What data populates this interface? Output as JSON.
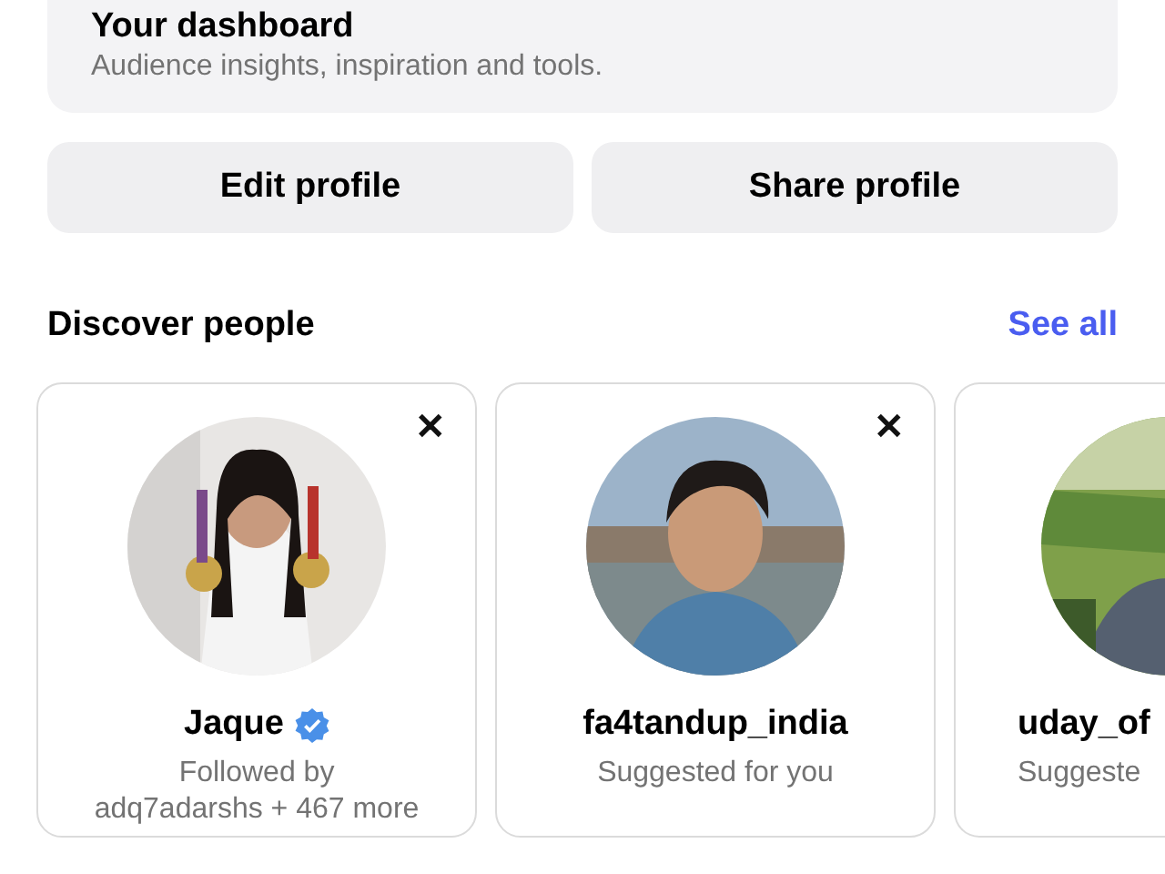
{
  "dashboard": {
    "title": "Your dashboard",
    "subtitle": "Audience insights, inspiration and tools."
  },
  "buttons": [
    "Edit profile",
    "Share profile"
  ],
  "discover": {
    "title": "Discover people",
    "link": "See all",
    "people": [
      {
        "name": "Jaque",
        "verified": true,
        "dismiss": "✕",
        "subtitle": [
          "Followed by",
          "adq7adarshs + 467 more"
        ]
      },
      {
        "name": "fa4tandup_india",
        "verified": false,
        "dismiss": "✕",
        "subtitle": [
          "Suggested for you"
        ]
      },
      {
        "name": "uday_of",
        "verified": false,
        "subtitle": [
          "Suggeste"
        ]
      }
    ]
  }
}
